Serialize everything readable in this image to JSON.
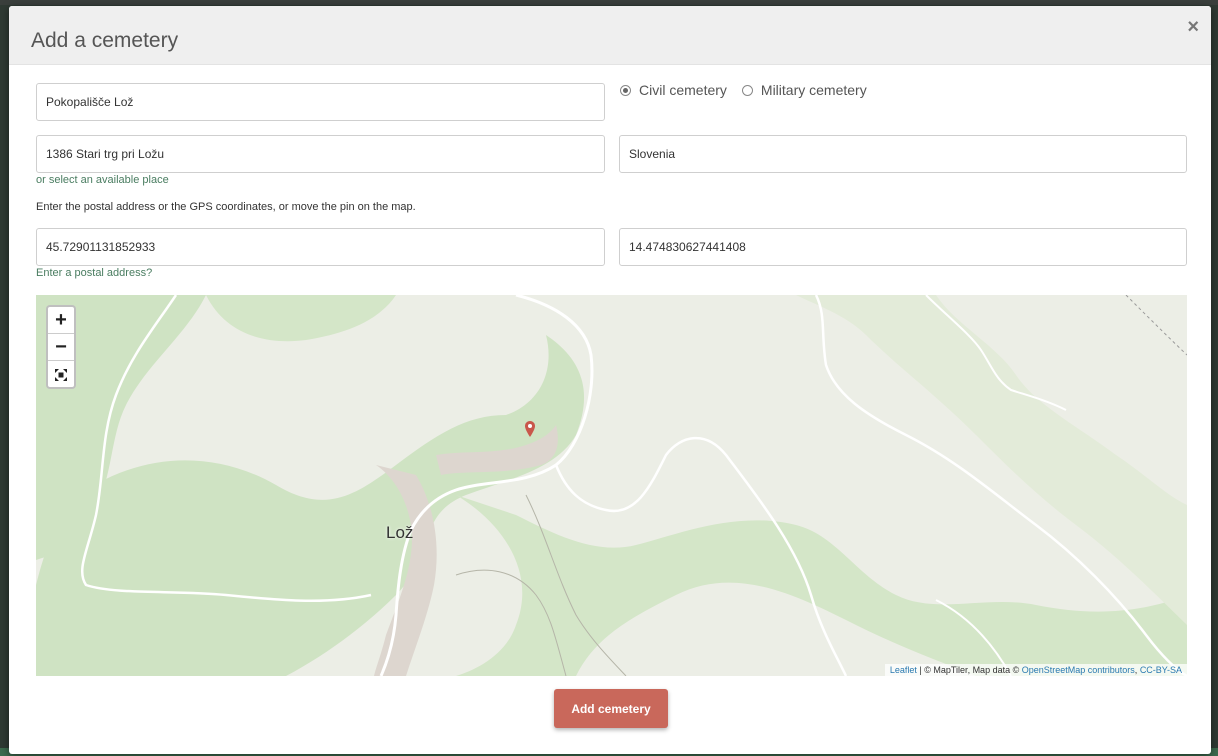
{
  "modal": {
    "title": "Add a cemetery",
    "close_label": "×"
  },
  "form": {
    "name_value": "Pokopališče Lož",
    "cemetery_type": {
      "options": [
        {
          "label": "Civil cemetery",
          "checked": true
        },
        {
          "label": "Military cemetery",
          "checked": false
        }
      ]
    },
    "city_value": "1386 Stari trg pri Ložu",
    "country_value": "Slovenia",
    "select_place_link": "or select an available place",
    "help_text": "Enter the postal address or the GPS coordinates, or move the pin on the map.",
    "latitude_value": "45.72901131852933",
    "longitude_value": "14.474830627441408",
    "postal_address_link": "Enter a postal address?"
  },
  "map": {
    "zoom_in_label": "+",
    "zoom_out_label": "−",
    "town_label": "Lož",
    "attribution": {
      "leaflet": "Leaflet",
      "separator": " | © ",
      "maptiler": "MapTiler",
      "map_data": ", Map data © ",
      "osm": "OpenStreetMap contributors",
      "comma": ", ",
      "license": "CC-BY-SA"
    },
    "colors": {
      "forest": "#cfe3c3",
      "land": "#eceee6",
      "road": "#ffffff",
      "urban": "#ddd6cf",
      "pin": "#c9574b"
    }
  },
  "submit_label": "Add cemetery"
}
